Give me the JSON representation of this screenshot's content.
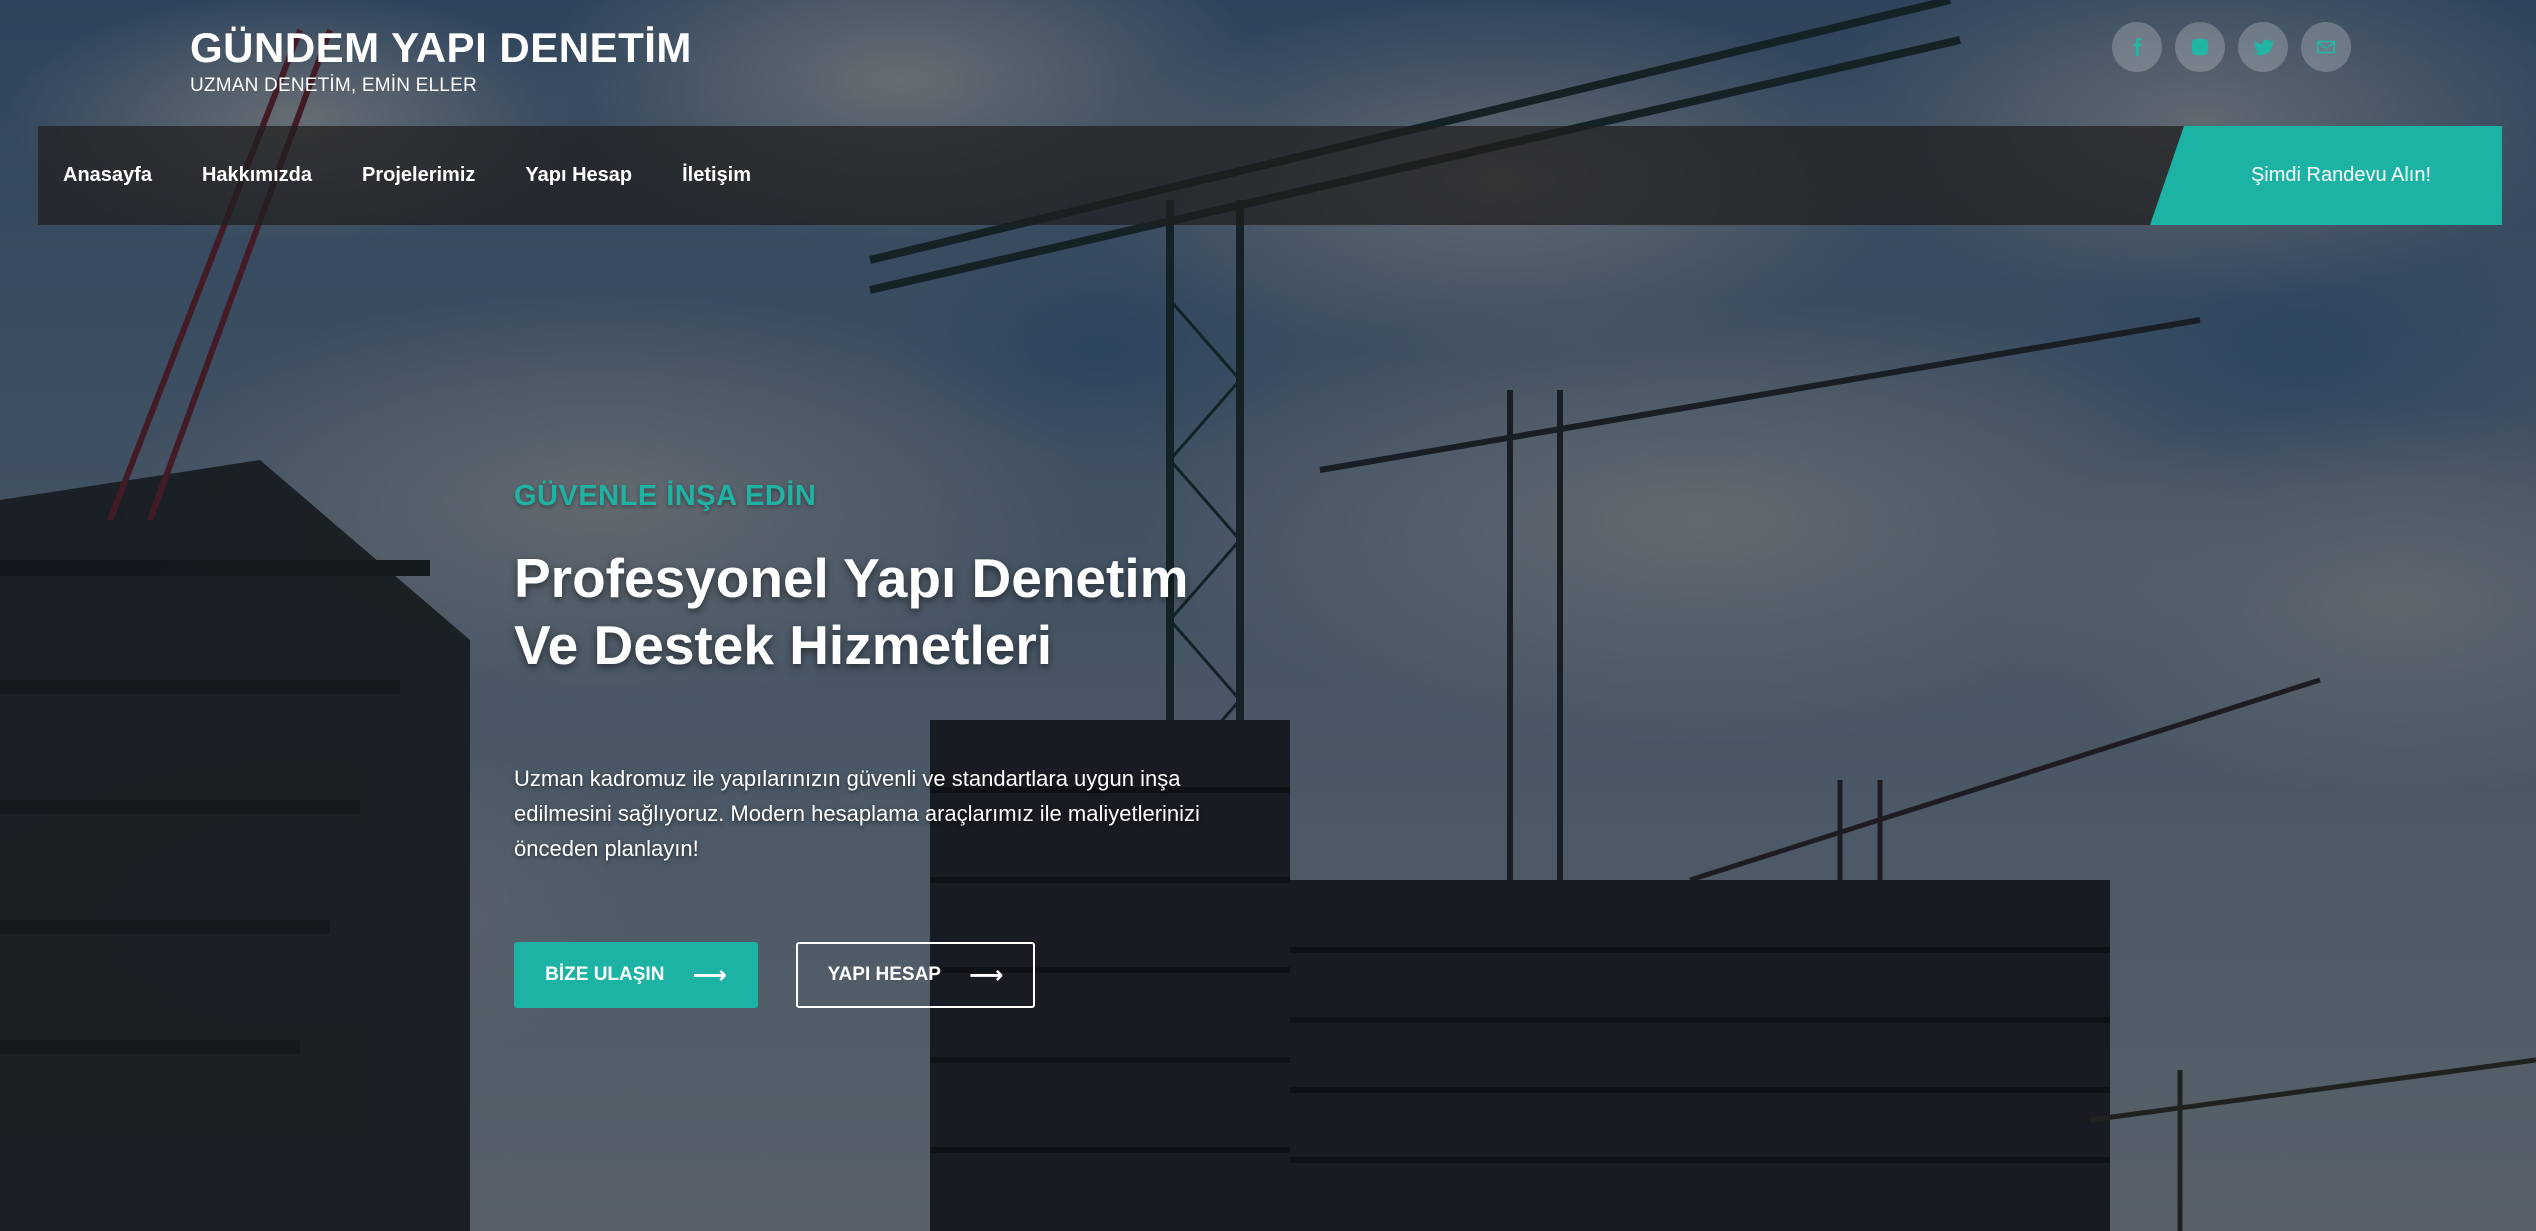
{
  "brand": {
    "title": "GÜNDEM YAPI DENETİM",
    "tagline": "UZMAN DENETİM, EMİN ELLER"
  },
  "socials": [
    {
      "name": "facebook-icon",
      "glyph": "f"
    },
    {
      "name": "instagram-icon",
      "glyph": ""
    },
    {
      "name": "twitter-icon",
      "glyph": ""
    },
    {
      "name": "email-icon",
      "glyph": ""
    }
  ],
  "nav": {
    "items": [
      {
        "label": "Anasayfa"
      },
      {
        "label": "Hakkımızda"
      },
      {
        "label": "Projelerimiz"
      },
      {
        "label": "Yapı Hesap"
      },
      {
        "label": "İletişim"
      }
    ],
    "cta_label": "Şimdi Randevu Alın!"
  },
  "hero": {
    "kicker": "GÜVENLE İNŞA EDİN",
    "title_line1": "Profesyonel Yapı Denetim",
    "title_line2": "Ve Destek Hizmetleri",
    "description": "Uzman kadromuz ile yapılarınızın güvenli ve standartlara uygun inşa edilmesini sağlıyoruz. Modern hesaplama araçlarımız ile maliyetlerinizi önceden planlayın!",
    "primary_button": "BİZE ULAŞIN",
    "secondary_button": "YAPI HESAP",
    "arrow": "⟶"
  },
  "colors": {
    "accent": "#1cb3a5",
    "navbar_bg": "#1e1e1e",
    "text": "#ffffff"
  }
}
